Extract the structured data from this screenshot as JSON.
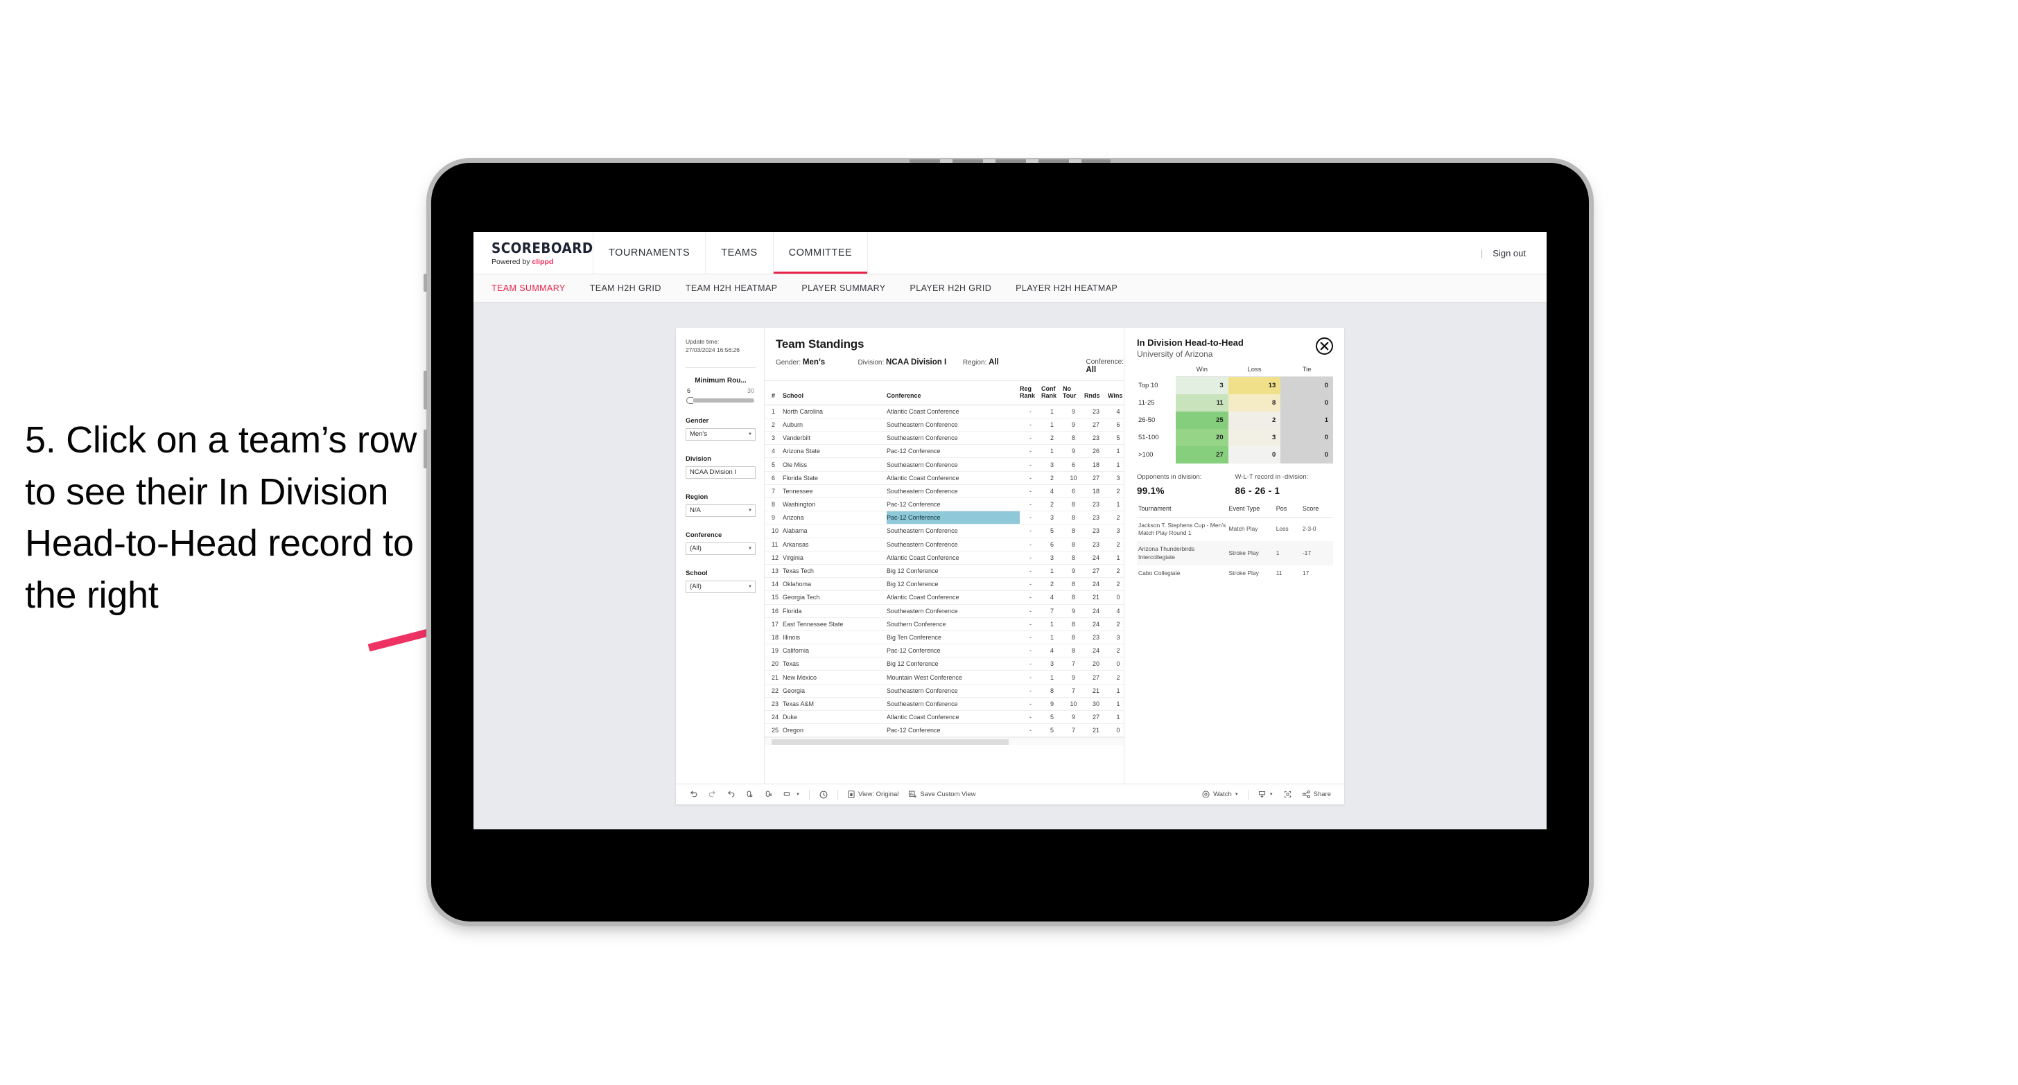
{
  "annotation": {
    "text": "5. Click on a team’s row to see their In Division Head-to-Head record to the right",
    "arrow_color": "#EE3364"
  },
  "app": {
    "brand": {
      "title": "SCOREBOARD",
      "powered_prefix": "Powered by ",
      "powered_name": "clippd"
    },
    "top_nav": [
      {
        "label": "TOURNAMENTS",
        "active": false
      },
      {
        "label": "TEAMS",
        "active": false
      },
      {
        "label": "COMMITTEE",
        "active": true
      }
    ],
    "sign_out": "Sign out",
    "sub_nav": [
      {
        "label": "TEAM SUMMARY",
        "active": true
      },
      {
        "label": "TEAM H2H GRID",
        "active": false
      },
      {
        "label": "TEAM H2H HEATMAP",
        "active": false
      },
      {
        "label": "PLAYER SUMMARY",
        "active": false
      },
      {
        "label": "PLAYER H2H GRID",
        "active": false
      },
      {
        "label": "PLAYER H2H HEATMAP",
        "active": false
      }
    ],
    "accent": "#E8234A"
  },
  "filters": {
    "update_time_label": "Update time:",
    "update_time_value": "27/03/2024 16:56:26",
    "slider": {
      "title": "Minimum Rou...",
      "min": "6",
      "max": "30"
    },
    "groups": [
      {
        "label": "Gender",
        "value": "Men’s"
      },
      {
        "label": "Division",
        "value": "NCAA Division I"
      },
      {
        "label": "Region",
        "value": "N/A"
      },
      {
        "label": "Conference",
        "value": "(All)"
      },
      {
        "label": "School",
        "value": "(All)"
      }
    ]
  },
  "standings": {
    "title": "Team Standings",
    "meta": [
      {
        "key": "Gender:",
        "value": "Men’s"
      },
      {
        "key": "Division:",
        "value": "NCAA Division I"
      },
      {
        "key": "Region:",
        "value": "All"
      },
      {
        "key": "Conference:",
        "value": "All"
      }
    ],
    "columns": [
      "#",
      "School",
      "Conference",
      "Reg Rank",
      "Conf Rank",
      "No Tour",
      "Rnds",
      "Wins"
    ],
    "rows": [
      {
        "rank": "1",
        "school": "North Carolina",
        "conference": "Atlantic Coast Conference",
        "reg_rank": "-",
        "conf_rank": "1",
        "no_tour": "9",
        "rnds": "23",
        "wins": "4",
        "selected": false
      },
      {
        "rank": "2",
        "school": "Auburn",
        "conference": "Southeastern Conference",
        "reg_rank": "-",
        "conf_rank": "1",
        "no_tour": "9",
        "rnds": "27",
        "wins": "6",
        "selected": false
      },
      {
        "rank": "3",
        "school": "Vanderbilt",
        "conference": "Southeastern Conference",
        "reg_rank": "-",
        "conf_rank": "2",
        "no_tour": "8",
        "rnds": "23",
        "wins": "5",
        "selected": false
      },
      {
        "rank": "4",
        "school": "Arizona State",
        "conference": "Pac-12 Conference",
        "reg_rank": "-",
        "conf_rank": "1",
        "no_tour": "9",
        "rnds": "26",
        "wins": "1",
        "selected": false
      },
      {
        "rank": "5",
        "school": "Ole Miss",
        "conference": "Southeastern Conference",
        "reg_rank": "-",
        "conf_rank": "3",
        "no_tour": "6",
        "rnds": "18",
        "wins": "1",
        "selected": false
      },
      {
        "rank": "6",
        "school": "Florida State",
        "conference": "Atlantic Coast Conference",
        "reg_rank": "-",
        "conf_rank": "2",
        "no_tour": "10",
        "rnds": "27",
        "wins": "3",
        "selected": false
      },
      {
        "rank": "7",
        "school": "Tennessee",
        "conference": "Southeastern Conference",
        "reg_rank": "-",
        "conf_rank": "4",
        "no_tour": "6",
        "rnds": "18",
        "wins": "2",
        "selected": false
      },
      {
        "rank": "8",
        "school": "Washington",
        "conference": "Pac-12 Conference",
        "reg_rank": "-",
        "conf_rank": "2",
        "no_tour": "8",
        "rnds": "23",
        "wins": "1",
        "selected": false
      },
      {
        "rank": "9",
        "school": "Arizona",
        "conference": "Pac-12 Conference",
        "reg_rank": "-",
        "conf_rank": "3",
        "no_tour": "8",
        "rnds": "23",
        "wins": "2",
        "selected": true
      },
      {
        "rank": "10",
        "school": "Alabama",
        "conference": "Southeastern Conference",
        "reg_rank": "-",
        "conf_rank": "5",
        "no_tour": "8",
        "rnds": "23",
        "wins": "3",
        "selected": false
      },
      {
        "rank": "11",
        "school": "Arkansas",
        "conference": "Southeastern Conference",
        "reg_rank": "-",
        "conf_rank": "6",
        "no_tour": "8",
        "rnds": "23",
        "wins": "2",
        "selected": false
      },
      {
        "rank": "12",
        "school": "Virginia",
        "conference": "Atlantic Coast Conference",
        "reg_rank": "-",
        "conf_rank": "3",
        "no_tour": "8",
        "rnds": "24",
        "wins": "1",
        "selected": false
      },
      {
        "rank": "13",
        "school": "Texas Tech",
        "conference": "Big 12 Conference",
        "reg_rank": "-",
        "conf_rank": "1",
        "no_tour": "9",
        "rnds": "27",
        "wins": "2",
        "selected": false
      },
      {
        "rank": "14",
        "school": "Oklahoma",
        "conference": "Big 12 Conference",
        "reg_rank": "-",
        "conf_rank": "2",
        "no_tour": "8",
        "rnds": "24",
        "wins": "2",
        "selected": false
      },
      {
        "rank": "15",
        "school": "Georgia Tech",
        "conference": "Atlantic Coast Conference",
        "reg_rank": "-",
        "conf_rank": "4",
        "no_tour": "8",
        "rnds": "21",
        "wins": "0",
        "selected": false
      },
      {
        "rank": "16",
        "school": "Florida",
        "conference": "Southeastern Conference",
        "reg_rank": "-",
        "conf_rank": "7",
        "no_tour": "9",
        "rnds": "24",
        "wins": "4",
        "selected": false
      },
      {
        "rank": "17",
        "school": "East Tennessee State",
        "conference": "Southern Conference",
        "reg_rank": "-",
        "conf_rank": "1",
        "no_tour": "8",
        "rnds": "24",
        "wins": "2",
        "selected": false
      },
      {
        "rank": "18",
        "school": "Illinois",
        "conference": "Big Ten Conference",
        "reg_rank": "-",
        "conf_rank": "1",
        "no_tour": "8",
        "rnds": "23",
        "wins": "3",
        "selected": false
      },
      {
        "rank": "19",
        "school": "California",
        "conference": "Pac-12 Conference",
        "reg_rank": "-",
        "conf_rank": "4",
        "no_tour": "8",
        "rnds": "24",
        "wins": "2",
        "selected": false
      },
      {
        "rank": "20",
        "school": "Texas",
        "conference": "Big 12 Conference",
        "reg_rank": "-",
        "conf_rank": "3",
        "no_tour": "7",
        "rnds": "20",
        "wins": "0",
        "selected": false
      },
      {
        "rank": "21",
        "school": "New Mexico",
        "conference": "Mountain West Conference",
        "reg_rank": "-",
        "conf_rank": "1",
        "no_tour": "9",
        "rnds": "27",
        "wins": "2",
        "selected": false
      },
      {
        "rank": "22",
        "school": "Georgia",
        "conference": "Southeastern Conference",
        "reg_rank": "-",
        "conf_rank": "8",
        "no_tour": "7",
        "rnds": "21",
        "wins": "1",
        "selected": false
      },
      {
        "rank": "23",
        "school": "Texas A&M",
        "conference": "Southeastern Conference",
        "reg_rank": "-",
        "conf_rank": "9",
        "no_tour": "10",
        "rnds": "30",
        "wins": "1",
        "selected": false
      },
      {
        "rank": "24",
        "school": "Duke",
        "conference": "Atlantic Coast Conference",
        "reg_rank": "-",
        "conf_rank": "5",
        "no_tour": "9",
        "rnds": "27",
        "wins": "1",
        "selected": false
      },
      {
        "rank": "25",
        "school": "Oregon",
        "conference": "Pac-12 Conference",
        "reg_rank": "-",
        "conf_rank": "5",
        "no_tour": "7",
        "rnds": "21",
        "wins": "0",
        "selected": false
      }
    ]
  },
  "h2h": {
    "title": "In Division Head-to-Head",
    "subtitle": "University of Arizona",
    "close_icon": "close-circle-icon",
    "chart_data": {
      "type": "heatmap",
      "title": "In Division Head-to-Head",
      "subtitle": "University of Arizona",
      "columns": [
        "Win",
        "Loss",
        "Tie"
      ],
      "rows": [
        "Top 10",
        "11-25",
        "26-50",
        "51-100",
        ">100"
      ],
      "values": [
        [
          3,
          13,
          0
        ],
        [
          11,
          8,
          0
        ],
        [
          25,
          2,
          1
        ],
        [
          20,
          3,
          0
        ],
        [
          27,
          0,
          0
        ]
      ],
      "cell_colors": [
        [
          "#e3efe0",
          "#f0e08a",
          "#d2d2d2"
        ],
        [
          "#c9e4bd",
          "#f5ecc6",
          "#d2d2d2"
        ],
        [
          "#84ce7d",
          "#f0eee6",
          "#d2d2d2"
        ],
        [
          "#96d588",
          "#f2efe4",
          "#d2d2d2"
        ],
        [
          "#86cf7c",
          "#f2f2f0",
          "#d2d2d2"
        ]
      ]
    },
    "summary": [
      {
        "label": "Opponents in division:",
        "value": "99.1%"
      },
      {
        "label": "W-L-T record in -division:",
        "value": "86 - 26 - 1"
      }
    ],
    "tournament_columns": [
      "Tournament",
      "Event Type",
      "Pos",
      "Score"
    ],
    "tournaments": [
      {
        "name": "Jackson T. Stephens Cup - Men’s Match Play Round 1",
        "type": "Match Play",
        "pos": "Loss",
        "score": "2-3-0"
      },
      {
        "name": "Arizona Thunderbirds Intercollegiate",
        "type": "Stroke Play",
        "pos": "1",
        "score": "-17"
      },
      {
        "name": "Cabo Collegiate",
        "type": "Stroke Play",
        "pos": "11",
        "score": "17"
      }
    ]
  },
  "viz_toolbar": {
    "view_label": "View: Original",
    "save_label": "Save Custom View",
    "watch_label": "Watch",
    "share_label": "Share"
  }
}
